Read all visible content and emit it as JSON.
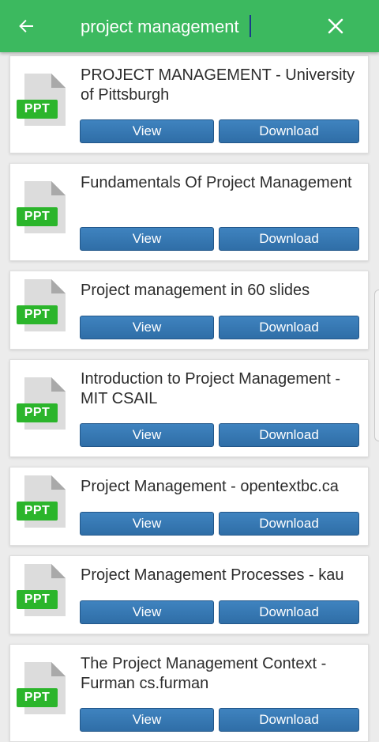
{
  "search": {
    "value": "project management",
    "placeholder": "Search"
  },
  "file_type_label": "PPT",
  "view_label": "View",
  "download_label": "Download",
  "colors": {
    "appbar": "#3cb95f",
    "badge": "#2bb52b",
    "button": "#3a7bb5"
  },
  "results": [
    {
      "title": "PROJECT MANAGEMENT - University of Pittsburgh"
    },
    {
      "title": "Fundamentals Of Project Management"
    },
    {
      "title": "Project management in 60 slides"
    },
    {
      "title": "Introduction to Project Management - MIT CSAIL"
    },
    {
      "title": "Project Management - opentextbc.ca"
    },
    {
      "title": "Project Management Processes - kau"
    },
    {
      "title": "The Project Management Context - Furman cs.furman"
    }
  ]
}
